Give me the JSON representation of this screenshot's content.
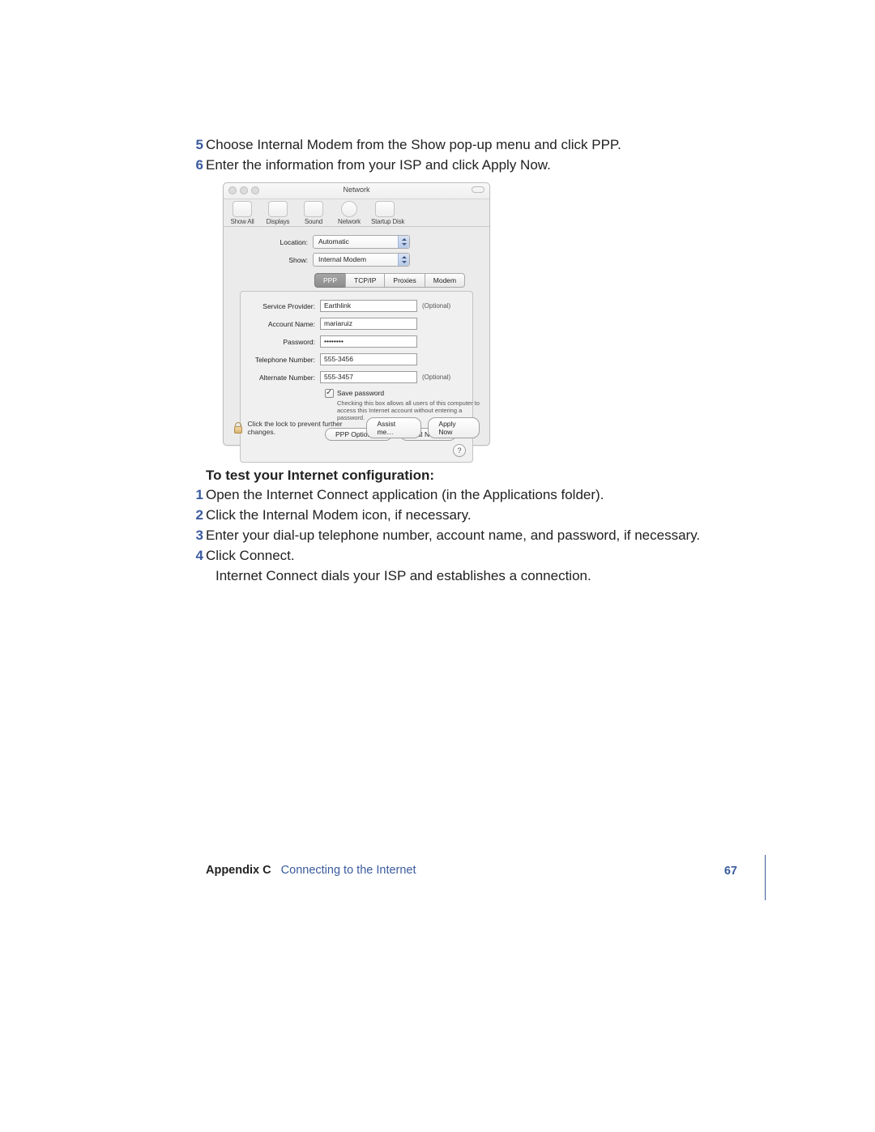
{
  "steps_top": [
    {
      "num": "5",
      "text": "Choose Internal Modem from the Show pop-up menu and click PPP."
    },
    {
      "num": "6",
      "text": "Enter the information from your ISP and click Apply Now."
    }
  ],
  "panel": {
    "title": "Network",
    "toolbar": [
      {
        "label": "Show All"
      },
      {
        "label": "Displays"
      },
      {
        "label": "Sound"
      },
      {
        "label": "Network"
      },
      {
        "label": "Startup Disk"
      }
    ],
    "location_label": "Location:",
    "location_value": "Automatic",
    "show_label": "Show:",
    "show_value": "Internal Modem",
    "tabs": [
      "PPP",
      "TCP/IP",
      "Proxies",
      "Modem"
    ],
    "fields": {
      "service_provider": {
        "label": "Service Provider:",
        "value": "Earthlink",
        "optional": "(Optional)"
      },
      "account_name": {
        "label": "Account Name:",
        "value": "mariaruiz"
      },
      "password": {
        "label": "Password:",
        "value": "••••••••"
      },
      "telephone": {
        "label": "Telephone Number:",
        "value": "555-3456"
      },
      "alternate": {
        "label": "Alternate Number:",
        "value": "555-3457",
        "optional": "(Optional)"
      }
    },
    "save_password": "Save password",
    "save_password_help": "Checking this box allows all users of this computer to access this Internet account without entering a password.",
    "ppp_options": "PPP Options…",
    "dial_now": "Dial Now…",
    "lock_text": "Click the lock to prevent further changes.",
    "assist_me": "Assist me…",
    "apply_now": "Apply Now",
    "help": "?"
  },
  "section_heading": "To test your Internet configuration:",
  "steps_bottom": [
    {
      "num": "1",
      "text": "Open the Internet Connect application (in the Applications folder)."
    },
    {
      "num": "2",
      "text": "Click the Internal Modem icon, if necessary."
    },
    {
      "num": "3",
      "text": "Enter your dial-up telephone number, account name, and password, if necessary."
    },
    {
      "num": "4",
      "text": "Click Connect."
    }
  ],
  "result_text": "Internet Connect dials your ISP and establishes a connection.",
  "footer": {
    "appendix": "Appendix C",
    "title": "Connecting to the Internet",
    "page": "67"
  }
}
